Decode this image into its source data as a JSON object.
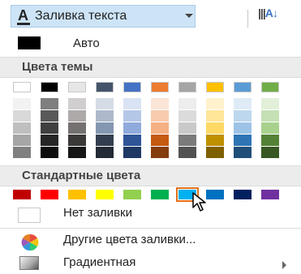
{
  "toolbar": {
    "font_glyph": "A",
    "fill_button_label": "Заливка текста",
    "sort_glyph": "A↓"
  },
  "menu": {
    "auto_label": "Авто",
    "theme_header": "Цвета темы",
    "standard_header": "Стандартные цвета",
    "no_fill_label": "Нет заливки",
    "more_colors_label": "Другие цвета заливки...",
    "gradient_label": "Градиентная"
  },
  "theme_colors": {
    "top_row": [
      "#ffffff",
      "#000000",
      "#e7e6e6",
      "#44546a",
      "#4472c4",
      "#ed7d31",
      "#a5a5a5",
      "#ffc000",
      "#5b9bd5",
      "#70ad47"
    ],
    "shades": [
      [
        "#f2f2f2",
        "#d9d9d9",
        "#bfbfbf",
        "#a6a6a6",
        "#808080"
      ],
      [
        "#7f7f7f",
        "#595959",
        "#404040",
        "#262626",
        "#0d0d0d"
      ],
      [
        "#d0cece",
        "#aeaaaa",
        "#757171",
        "#3b3838",
        "#171616"
      ],
      [
        "#d6dce5",
        "#adb9ca",
        "#8497b0",
        "#333f50",
        "#222a35"
      ],
      [
        "#dae3f3",
        "#b4c7e7",
        "#8faadc",
        "#2f5597",
        "#1f3864"
      ],
      [
        "#fbe5d6",
        "#f8cbad",
        "#f4b183",
        "#c55a11",
        "#843c0c"
      ],
      [
        "#ededed",
        "#dbdbdb",
        "#c9c9c9",
        "#7b7b7b",
        "#525252"
      ],
      [
        "#fff2cc",
        "#ffe699",
        "#ffd966",
        "#bf9000",
        "#7f6000"
      ],
      [
        "#deebf7",
        "#bdd7ee",
        "#9dc3e6",
        "#2e75b6",
        "#1f4e79"
      ],
      [
        "#e2f0d9",
        "#c5e0b4",
        "#a9d18e",
        "#548235",
        "#385723"
      ]
    ]
  },
  "standard_colors": [
    "#c00000",
    "#ff0000",
    "#ffc000",
    "#ffff00",
    "#92d050",
    "#00b050",
    "#00b0f0",
    "#0070c0",
    "#002060",
    "#7030a0"
  ],
  "selected_standard_index": 6
}
